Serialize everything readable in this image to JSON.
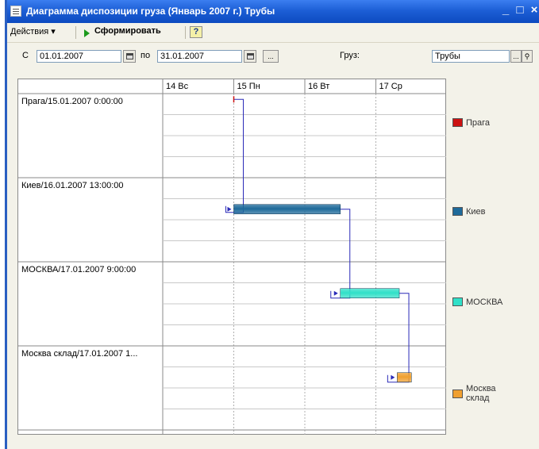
{
  "window": {
    "title": "Диаграмма диспозиции груза (Январь 2007 г.) Трубы"
  },
  "toolbar": {
    "actions_label": "Действия ▾",
    "generate_label": "Сформировать",
    "help_label": "?"
  },
  "filters": {
    "from_label": "С",
    "from_value": "01.01.2007",
    "to_label": "по",
    "to_value": "31.01.2007",
    "ellipsis": "...",
    "cargo_label": "Груз:",
    "cargo_value": "Трубы"
  },
  "gantt": {
    "days": [
      "14 Вс",
      "15 Пн",
      "16 Вт",
      "17 Ср"
    ],
    "rows": [
      {
        "label": "Прага/15.01.2007 0:00:00",
        "color": "#cc1111",
        "legend": [
          "Прага"
        ]
      },
      {
        "label": "Киев/16.01.2007 13:00:00",
        "color": "#1e6a9a",
        "legend": [
          "Киев"
        ]
      },
      {
        "label": "МОСКВА/17.01.2007 9:00:00",
        "color": "#30e0c8",
        "legend": [
          "МОСКВА"
        ]
      },
      {
        "label": "Москва склад/17.01.2007 1...",
        "color": "#f0a030",
        "legend": [
          "Москва",
          "склад"
        ]
      }
    ],
    "link_color": "#2a2ab8"
  }
}
